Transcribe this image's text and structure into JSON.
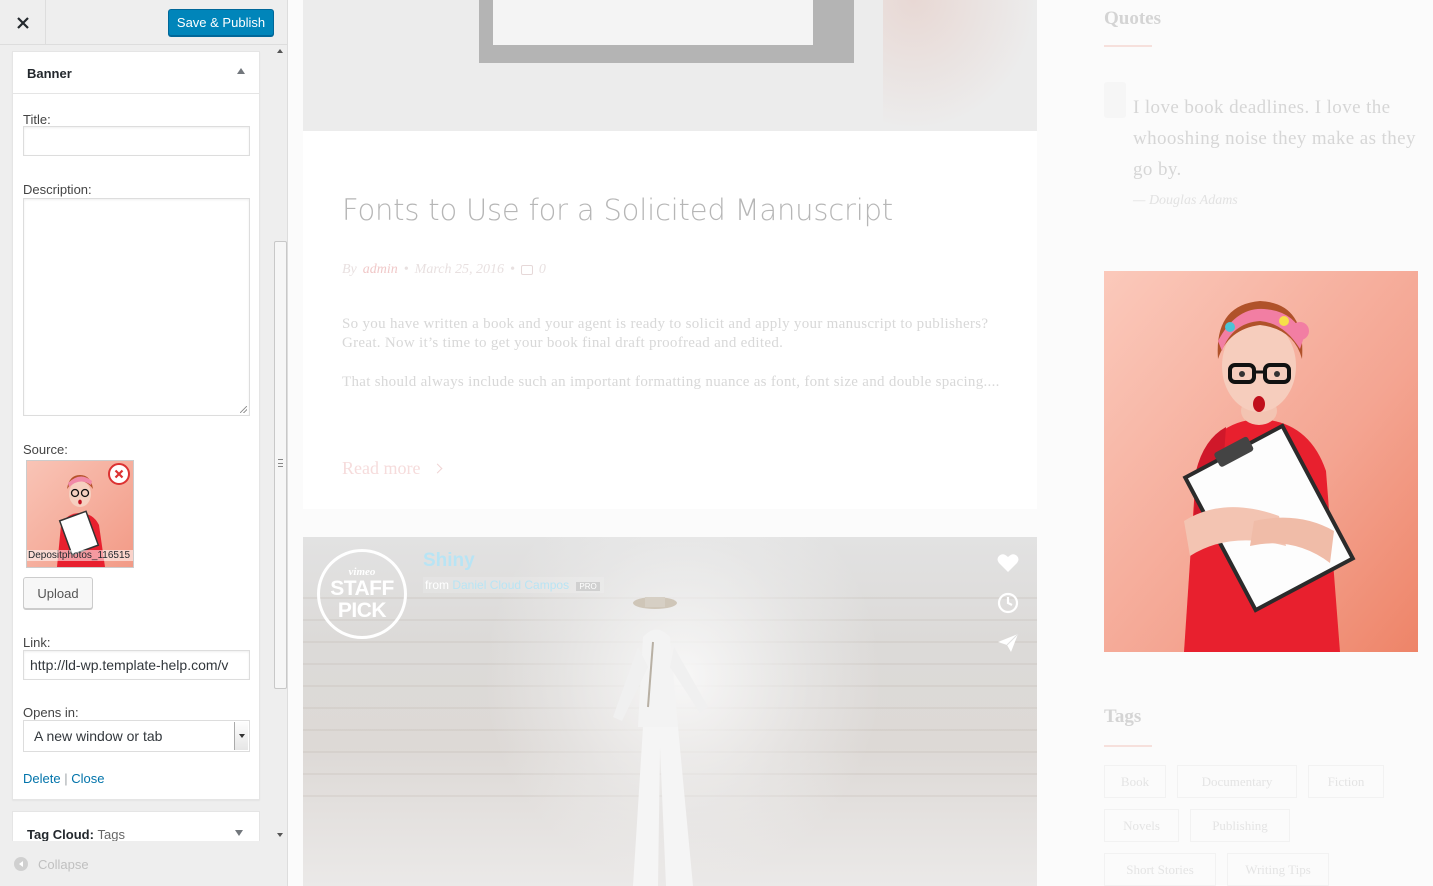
{
  "customizer": {
    "close_icon": "close-icon",
    "publish_button": "Save & Publish",
    "widget": {
      "title": "Banner",
      "fields": {
        "title_label": "Title:",
        "title_value": "",
        "description_label": "Description:",
        "description_value": "",
        "source_label": "Source:",
        "source_filename": "Depositphotos_116515",
        "upload_button": "Upload",
        "link_label": "Link:",
        "link_value": "http://ld-wp.template-help.com/v",
        "opens_in_label": "Opens in:",
        "opens_in_value": "A new window or tab"
      },
      "delete_link": "Delete",
      "separator": "|",
      "close_link": "Close"
    },
    "next_widget": {
      "title": "Tag Cloud:",
      "subtitle": "Tags"
    },
    "collapse_label": "Collapse"
  },
  "preview": {
    "post": {
      "title": "Fonts to Use for a Solicited Manuscript",
      "by": "By",
      "author": "admin",
      "date": "March 25, 2016",
      "comments": "0",
      "paragraph_1": "So you have written a book and your agent is ready to solicit and apply your manuscript to publishers? Great. Now it’s time to get your book final draft proofread and edited.",
      "paragraph_2": "That should always include such an important formatting nuance as font, font size and double spacing....",
      "read_more": "Read more"
    },
    "video": {
      "badge_vimeo": "vimeo",
      "badge_line1": "STAFF",
      "badge_line2": "PICK",
      "title": "Shiny",
      "from": "from",
      "owner": "Daniel Cloud Campos",
      "pro_badge": "PRO"
    },
    "sidebar": {
      "quotes_heading": "Quotes",
      "quote_text": "I love book deadlines. I love the whooshing noise they make as they go by.",
      "quote_author": "— Douglas Adams",
      "tags_heading": "Tags",
      "tags": [
        "Book",
        "Documentary",
        "Fiction",
        "Novels",
        "Publishing",
        "Short Stories",
        "Writing Tips"
      ]
    }
  },
  "colors": {
    "publish": "#0085ba",
    "link": "#0073aa",
    "remove": "#dc3232",
    "banner_bg": "#f7b5a6",
    "dress": "#e8202e"
  }
}
